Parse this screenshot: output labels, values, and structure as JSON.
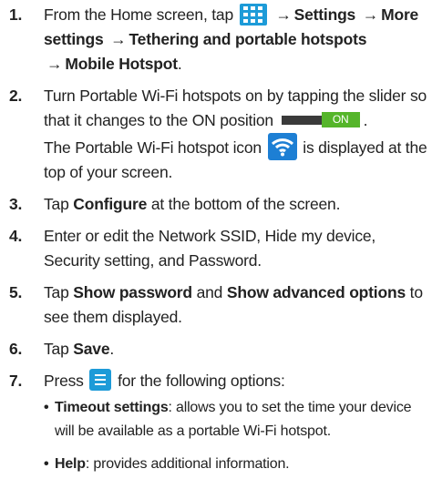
{
  "steps": [
    {
      "num": "1.",
      "pre": "From the Home screen, tap",
      "arrow1": "→",
      "b1": "Settings",
      "arrow2": "→",
      "b2": "More settings",
      "arrow3": "→",
      "b3": "Tethering and portable hotspots",
      "arrow4": "→",
      "b4": "Mobile Hotspot",
      "post": ".",
      "icon": "apps-grid-icon"
    },
    {
      "num": "2.",
      "text1": "Turn Portable Wi-Fi hotspots on by tapping the slider so that it changes to the ON position",
      "slider_label": "ON",
      "text1_end": ".",
      "text2_pre": "The Portable Wi-Fi hotspot icon",
      "text2_post": "is displayed at the top of your screen.",
      "icon": "wifi-hotspot-icon"
    },
    {
      "num": "3.",
      "pre": "Tap",
      "bold": "Configure",
      "post": "at the bottom of the screen."
    },
    {
      "num": "4.",
      "text": "Enter or edit the Network SSID, Hide my device, Security setting, and Password."
    },
    {
      "num": "5.",
      "pre": "Tap",
      "bold1": "Show password",
      "mid": "and",
      "bold2": "Show advanced options",
      "post": "to see them displayed."
    },
    {
      "num": "6.",
      "pre": "Tap",
      "bold": "Save",
      "post": "."
    },
    {
      "num": "7.",
      "pre": "Press",
      "post": "for the following options:",
      "icon": "menu-icon",
      "bullets": [
        {
          "dot": "•",
          "bold": "Timeout settings",
          "text": ": allows you to set the time your device will be available as a portable Wi-Fi hotspot."
        },
        {
          "dot": "•",
          "bold": "Help",
          "text": ": provides additional information."
        }
      ]
    }
  ],
  "colors": {
    "text": "#222222",
    "icon_blue": "#1d9bd8",
    "slider_on": "#55b52a",
    "slider_track": "#3a3a3a"
  }
}
